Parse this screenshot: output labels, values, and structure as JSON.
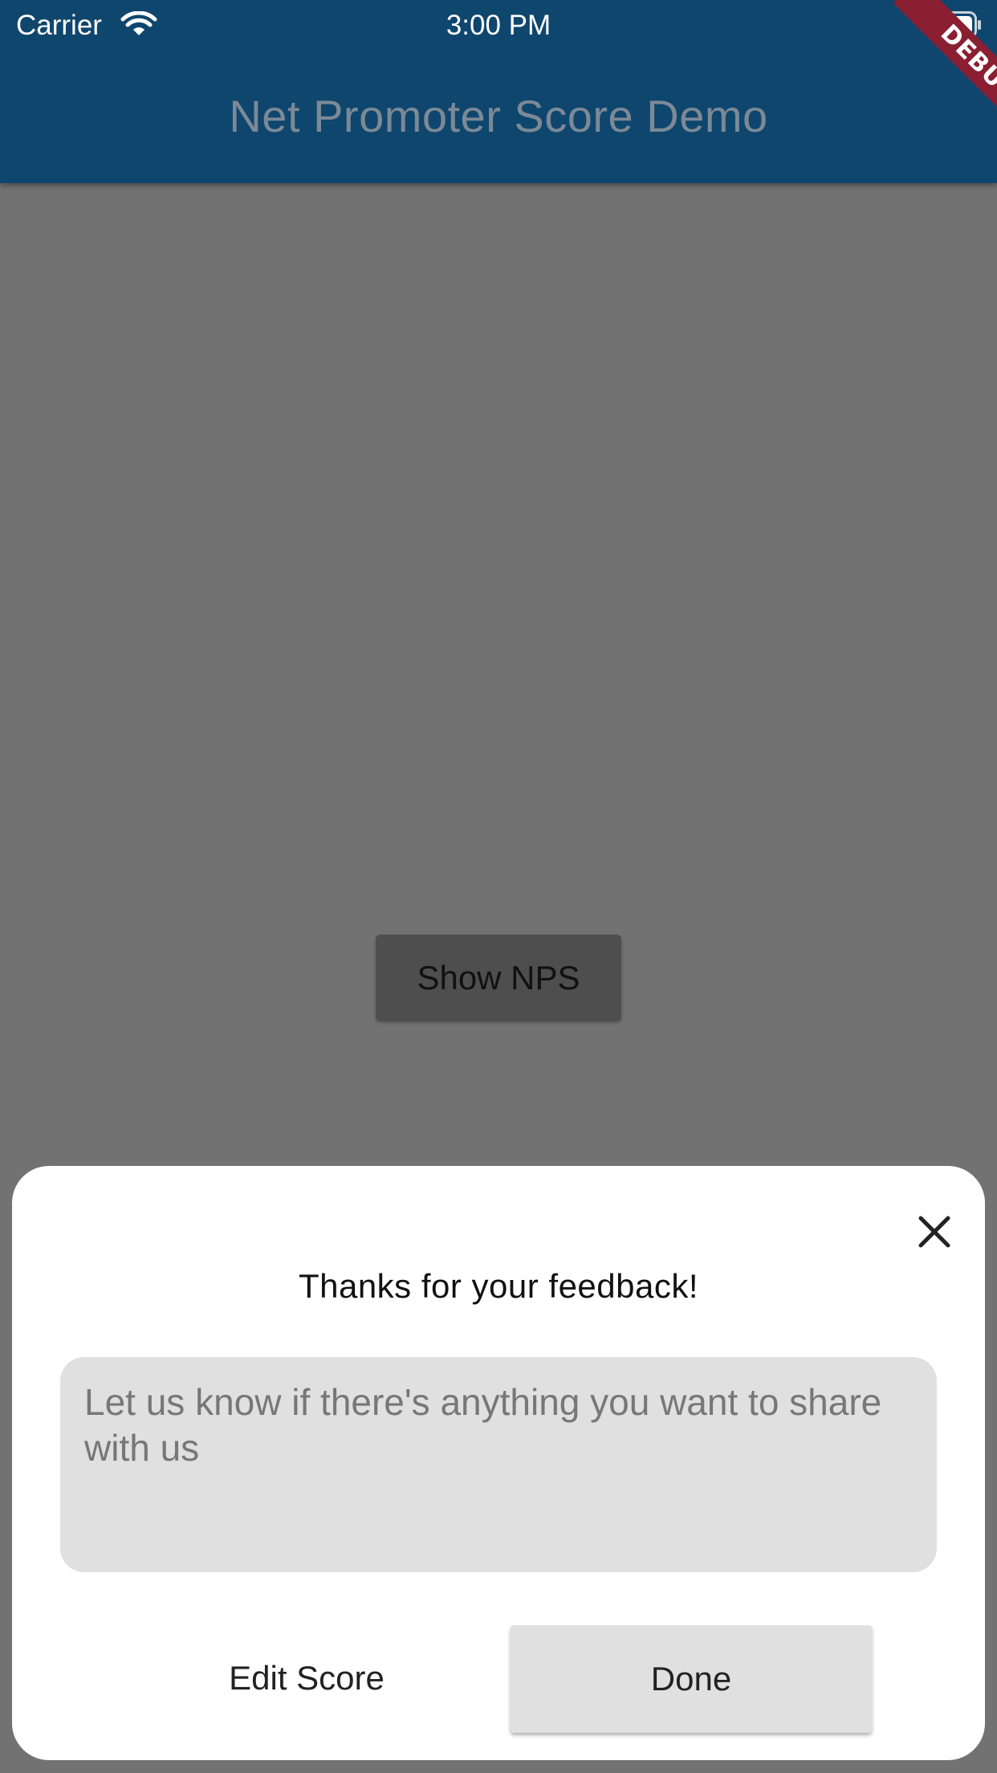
{
  "status_bar": {
    "carrier": "Carrier",
    "time": "3:00 PM",
    "wifi_icon": "wifi-icon",
    "battery_icon": "battery-icon"
  },
  "app_bar": {
    "title": "Net Promoter Score Demo",
    "background_color": "#0f466e",
    "debug_banner": "DEBUG"
  },
  "main": {
    "show_nps_label": "Show NPS"
  },
  "sheet": {
    "close_icon": "close-icon",
    "title": "Thanks for your feedback!",
    "feedback_value": "",
    "feedback_placeholder": "Let us know if there's anything you want to share with us",
    "edit_score_label": "Edit Score",
    "done_label": "Done"
  }
}
